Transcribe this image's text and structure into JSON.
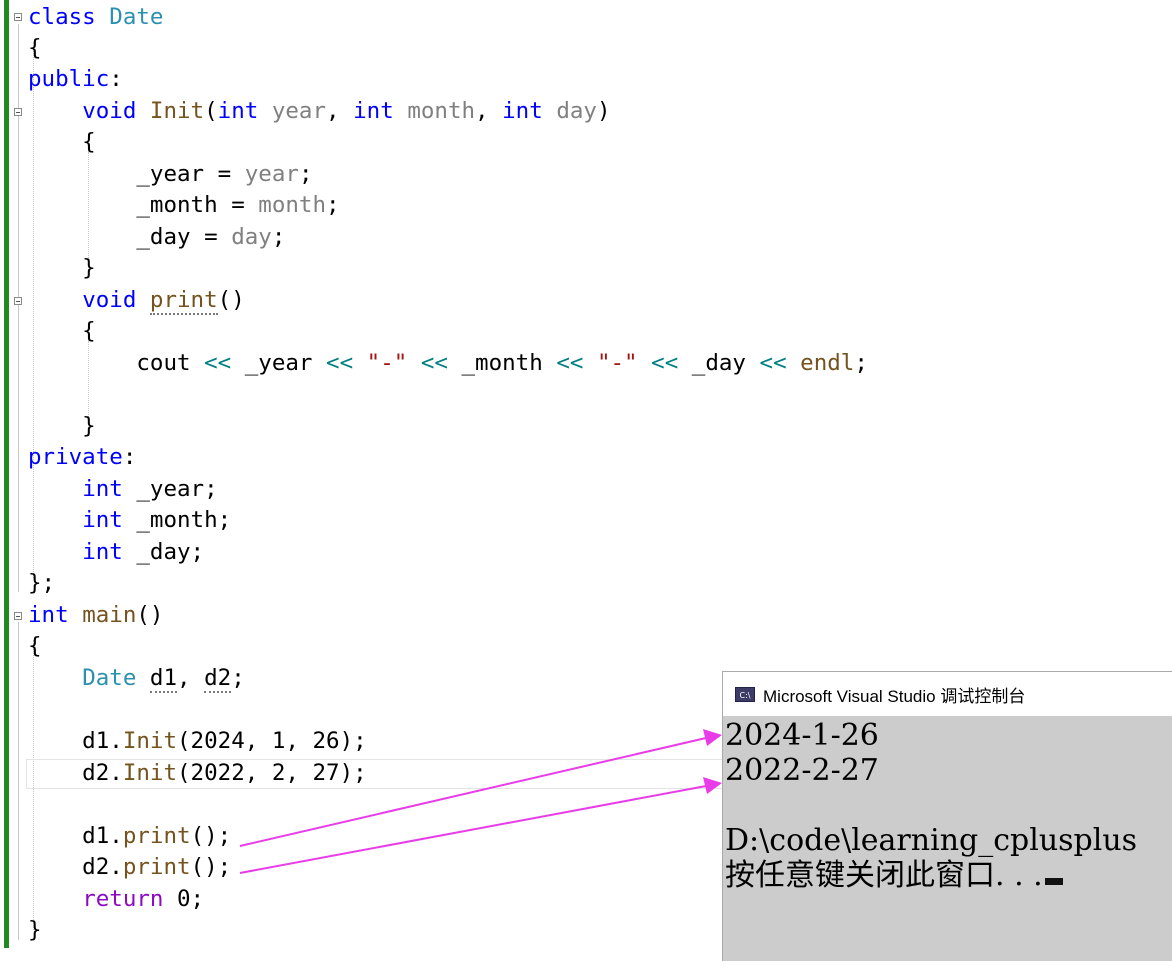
{
  "editor": {
    "lines": {
      "l1": [
        "class",
        " ",
        "Date"
      ],
      "l2": [
        "{"
      ],
      "l3": [
        "public",
        ":"
      ],
      "l4": [
        "    ",
        "void",
        " ",
        "Init",
        "(",
        "int",
        " ",
        "year",
        ", ",
        "int",
        " ",
        "month",
        ", ",
        "int",
        " ",
        "day",
        ")"
      ],
      "l5": [
        "    {"
      ],
      "l6": [
        "        _year = ",
        "year",
        ";"
      ],
      "l7": [
        "        _month = ",
        "month",
        ";"
      ],
      "l8": [
        "        _day = ",
        "day",
        ";"
      ],
      "l9": [
        "    }"
      ],
      "l10": [
        "    ",
        "void",
        " ",
        "print",
        "()"
      ],
      "l11": [
        "    {"
      ],
      "l12": [
        "        cout ",
        "<<",
        " _year ",
        "<<",
        " ",
        "\"-\"",
        " ",
        "<<",
        " _month ",
        "<<",
        " ",
        "\"-\"",
        " ",
        "<<",
        " _day ",
        "<<",
        " ",
        "endl",
        ";"
      ],
      "l13": [
        ""
      ],
      "l14": [
        "    }"
      ],
      "l15": [
        "private",
        ":"
      ],
      "l16": [
        "    ",
        "int",
        " _year;"
      ],
      "l17": [
        "    ",
        "int",
        " _month;"
      ],
      "l18": [
        "    ",
        "int",
        " _day;"
      ],
      "l19": [
        "};"
      ],
      "l20": [
        "int",
        " ",
        "main",
        "()"
      ],
      "l21": [
        "{"
      ],
      "l22": [
        "    ",
        "Date",
        " ",
        "d1",
        ", ",
        "d2",
        ";"
      ],
      "l23": [
        ""
      ],
      "l24": [
        "    d1.",
        "Init",
        "(2024, 1, 26);"
      ],
      "l25": [
        "    d2.",
        "Init",
        "(2022, 2, 27);"
      ],
      "l26": [
        ""
      ],
      "l27": [
        "    d1.",
        "print",
        "();"
      ],
      "l28": [
        "    d2.",
        "print",
        "();"
      ],
      "l29": [
        "    ",
        "return",
        " 0;"
      ],
      "l30": [
        "}"
      ]
    }
  },
  "console": {
    "icon_text": "C:\\",
    "icon": "console-app-icon",
    "title": "Microsoft Visual Studio 调试控制台",
    "output": [
      "2024-1-26",
      "2022-2-27",
      "",
      "D:\\code\\learning_cplusplus",
      "按任意键关闭此窗口. . ."
    ]
  },
  "annotation": {
    "arrow_color": "#e83ce8"
  }
}
